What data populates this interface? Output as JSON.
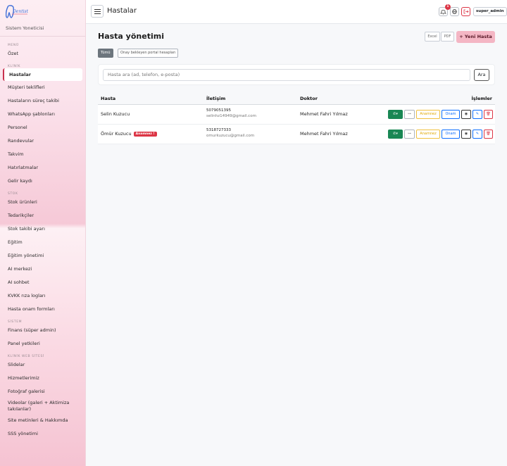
{
  "sidebar": {
    "logo_text": "Dentist",
    "role": "Sistem Yoneticisi",
    "sections": {
      "menu": "MENÜ",
      "clinic": "KLİNİK",
      "stock": "STOK",
      "system": "SİSTEM",
      "website": "KLİNİK WEB SİTESİ"
    },
    "items": {
      "ozet": "Özet",
      "hastalar": "Hastalar",
      "teklifler": "Müşteri teklifleri",
      "surec": "Hastaların süreç takibi",
      "whatsapp": "WhatsApp şablonları",
      "personel": "Personel",
      "randevular": "Randevular",
      "takvim": "Takvim",
      "hatirlatmalar": "Hatırlatmalar",
      "gelir": "Gelir kaydı",
      "stok_urunleri": "Stok ürünleri",
      "tedarikciler": "Tedarikçiler",
      "stok_ayari": "Stok takibi ayarı",
      "egitim": "Eğitim",
      "egitim_yonetimi": "Eğitim yönetimi",
      "ai_merkezi": "AI merkezi",
      "ai_sohbet": "AI sohbet",
      "kvkk": "KVKK rıza logları",
      "onam": "Hasta onam formları",
      "finans": "Finans (süper admin)",
      "panel_yetkileri": "Panel yetkileri",
      "slidelar": "Slidelar",
      "hizmetlerimiz": "Hizmetlerimiz",
      "fotograf": "Fotoğraf galerisi",
      "videolar": "Videolar (galeri + Aktimiza takılanlar)",
      "site_metinleri": "Site metinleri & Hakkımda",
      "sss": "SSS yönetimi"
    }
  },
  "topbar": {
    "title": "Hastalar",
    "notification_count": "1",
    "user": "super_admin"
  },
  "main": {
    "title": "Hasta yönetimi",
    "excel": "Excel",
    "pdf": "PDF",
    "new_patient": "+ Yeni Hasta",
    "filters": [
      "Tümü",
      "Onay bekleyen portal hesapları"
    ],
    "search_placeholder": "Hasta ara (ad, telefon, e-posta)",
    "search_button": "Ara"
  },
  "table": {
    "headers": {
      "patient": "Hasta",
      "contact": "İletişim",
      "doctor": "Doktor",
      "actions": "İşlemler"
    },
    "rows": [
      {
        "name": "Selin Kuzucu",
        "tag": "",
        "phone": "5079051395",
        "email": "selinhz14949@gmail.com",
        "doctor": "Mehmet Fahri Yılmaz"
      },
      {
        "name": "Ömür Kuzucu",
        "tag": "Anamnez !",
        "phone": "5318727333",
        "email": "omurkuzucu@gmail.com",
        "doctor": "Mehmet Fahri Yılmaz"
      }
    ],
    "action_labels": {
      "anamnez": "Anamnez",
      "onam": "Onam"
    }
  },
  "colors": {
    "accent_pink": "#f4b6c4",
    "whatsapp_green": "#198754",
    "danger": "#dc3545",
    "anamnez_yellow": "#f0c040",
    "onam_blue": "#0d6efd"
  }
}
